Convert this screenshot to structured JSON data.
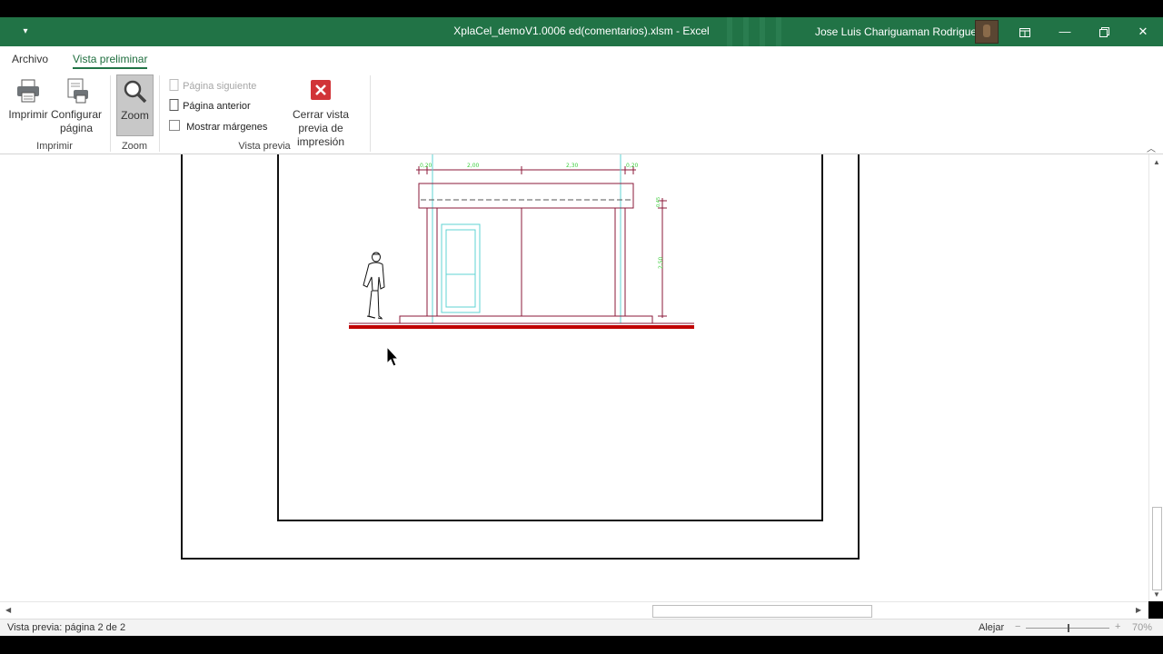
{
  "window": {
    "title": "XplaCel_demoV1.0006 ed(comentarios).xlsm  -  Excel",
    "user": "Jose Luis Chariguaman Rodriguez",
    "qat_icon": "dropdown-arrow-icon",
    "ribbon_display_icon": "ribbon-display-options-icon",
    "minimize_icon": "minimize-icon",
    "restore_icon": "restore-icon",
    "close_icon": "close-icon",
    "accent_color": "#217346"
  },
  "tabs": [
    {
      "label": "Archivo"
    },
    {
      "label": "Vista preliminar",
      "active": true
    }
  ],
  "ribbon": {
    "print_label": "Imprimir",
    "page_setup_label": "Configurar página",
    "zoom_label": "Zoom",
    "next_page_label": "Página siguiente",
    "prev_page_label": "Página anterior",
    "show_margins_label": "Mostrar márgenes",
    "close_preview_label": "Cerrar vista previa de impresión",
    "groups": {
      "imprimir": "Imprimir",
      "zoom": "Zoom",
      "vista_previa": "Vista previa"
    }
  },
  "drawing": {
    "dim_left": "0,20",
    "dim_mid1": "2,00",
    "dim_mid2": "2,30",
    "dim_right": "0,20",
    "dim_vert_top": "0,45",
    "dim_vert": "2,50",
    "line_color": "#8b1a3a",
    "accent_line_color": "#5fd3d3",
    "dim_color": "#3ecf3e",
    "ground_color": "#c00000"
  },
  "status": {
    "page_text": "Vista previa: página 2 de 2",
    "zoom_out_label": "Alejar",
    "zoom_percent": "70%"
  }
}
